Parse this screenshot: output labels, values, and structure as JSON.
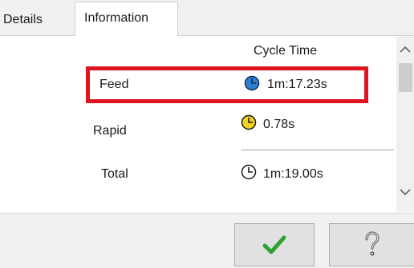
{
  "tabs": [
    {
      "label": "Details",
      "active": false
    },
    {
      "label": "Information",
      "active": true
    }
  ],
  "table": {
    "column_header": "Cycle Time",
    "rows": [
      {
        "label": "Feed",
        "value": "1m:17.23s",
        "icon": "clock-blue-icon",
        "highlighted": true
      },
      {
        "label": "Rapid",
        "value": "0.78s",
        "icon": "clock-yellow-icon",
        "highlighted": false
      },
      {
        "label": "Total",
        "value": "1m:19.00s",
        "icon": "clock-white-icon",
        "highlighted": false
      }
    ]
  },
  "buttons": {
    "ok_icon": "checkmark-icon",
    "help_icon": "question-mark-icon"
  },
  "colors": {
    "highlight": "#e0141e",
    "feed_clock": "#2f7fd1",
    "rapid_clock": "#f2d21b",
    "total_clock": "#ffffff",
    "ok_check": "#2ea12e"
  }
}
